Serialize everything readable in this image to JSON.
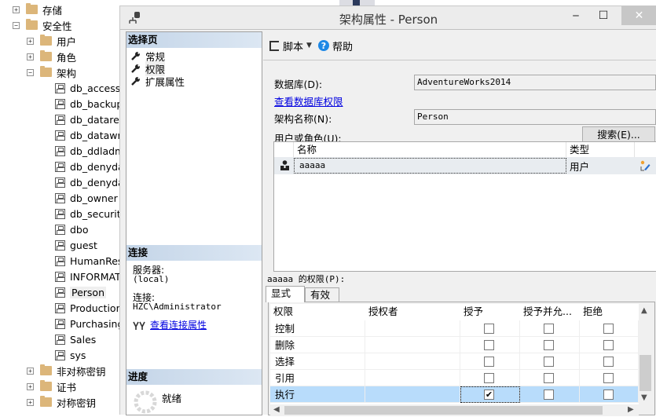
{
  "tree": {
    "nodes": [
      {
        "label": "存储",
        "type": "folder",
        "expander": "+",
        "level": 0
      },
      {
        "label": "安全性",
        "type": "folder",
        "expander": "-",
        "level": 0
      },
      {
        "label": "用户",
        "type": "folder",
        "expander": "+",
        "level": 1
      },
      {
        "label": "角色",
        "type": "folder",
        "expander": "+",
        "level": 1
      },
      {
        "label": "架构",
        "type": "folder",
        "expander": "-",
        "level": 1
      },
      {
        "label": "db_accessadmin",
        "type": "schema",
        "level": 2
      },
      {
        "label": "db_backupoperator",
        "type": "schema",
        "level": 2
      },
      {
        "label": "db_datareader",
        "type": "schema",
        "level": 2
      },
      {
        "label": "db_datawriter",
        "type": "schema",
        "level": 2
      },
      {
        "label": "db_ddladmin",
        "type": "schema",
        "level": 2
      },
      {
        "label": "db_denydatareader",
        "type": "schema",
        "level": 2
      },
      {
        "label": "db_denydatawriter",
        "type": "schema",
        "level": 2
      },
      {
        "label": "db_owner",
        "type": "schema",
        "level": 2
      },
      {
        "label": "db_securityadmin",
        "type": "schema",
        "level": 2
      },
      {
        "label": "dbo",
        "type": "schema",
        "level": 2
      },
      {
        "label": "guest",
        "type": "schema",
        "level": 2
      },
      {
        "label": "HumanResources",
        "type": "schema",
        "level": 2
      },
      {
        "label": "INFORMATION_SCHEMA",
        "type": "schema",
        "level": 2
      },
      {
        "label": "Person",
        "type": "schema",
        "level": 2,
        "selected": true
      },
      {
        "label": "Production",
        "type": "schema",
        "level": 2
      },
      {
        "label": "Purchasing",
        "type": "schema",
        "level": 2
      },
      {
        "label": "Sales",
        "type": "schema",
        "level": 2
      },
      {
        "label": "sys",
        "type": "schema",
        "level": 2
      },
      {
        "label": "非对称密钥",
        "type": "folder",
        "expander": "+",
        "level": 1
      },
      {
        "label": "证书",
        "type": "folder",
        "expander": "+",
        "level": 1
      },
      {
        "label": "对称密钥",
        "type": "folder",
        "expander": "+",
        "level": 1
      }
    ]
  },
  "dialog": {
    "title": "架构属性 - Person",
    "window_buttons": {
      "minimize": "‒",
      "maximize": "☐",
      "close": "✕"
    },
    "select_page": {
      "header": "选择页",
      "items": [
        {
          "label": "常规",
          "icon": "wrench-icon"
        },
        {
          "label": "权限",
          "icon": "wrench-icon",
          "selected": true
        },
        {
          "label": "扩展属性",
          "icon": "wrench-icon"
        }
      ]
    },
    "connection": {
      "header": "连接",
      "server_label": "服务器:",
      "server_value": "(local)",
      "connection_label": "连接:",
      "connection_value": "HZC\\Administrator",
      "view_props_link": "查看连接属性"
    },
    "progress": {
      "header": "进度",
      "status": "就绪"
    },
    "toolbar": {
      "script_label": "脚本",
      "help_label": "帮助"
    },
    "form": {
      "database_label": "数据库(D):",
      "database_value": "AdventureWorks2014",
      "view_db_perms_link": "查看数据库权限",
      "schema_name_label": "架构名称(N):",
      "schema_name_value": "Person",
      "users_roles_label": "用户或角色(U):",
      "search_button": "搜索(E)..."
    },
    "users_grid": {
      "columns": [
        "名称",
        "类型"
      ],
      "rows": [
        {
          "name": "aaaaa",
          "type": "用户"
        }
      ]
    },
    "permissions": {
      "label": "aaaaa 的权限(P):",
      "tabs": [
        "显式",
        "有效"
      ],
      "active_tab": "显式",
      "columns": [
        "权限",
        "授权者",
        "授予",
        "授予并允...",
        "拒绝"
      ],
      "rows": [
        {
          "permission": "控制",
          "grantor": "",
          "grant": false,
          "with_grant": false,
          "deny": false
        },
        {
          "permission": "删除",
          "grantor": "",
          "grant": false,
          "with_grant": false,
          "deny": false
        },
        {
          "permission": "选择",
          "grantor": "",
          "grant": false,
          "with_grant": false,
          "deny": false
        },
        {
          "permission": "引用",
          "grantor": "",
          "grant": false,
          "with_grant": false,
          "deny": false
        },
        {
          "permission": "执行",
          "grantor": "",
          "grant": true,
          "with_grant": false,
          "deny": false,
          "selected": true
        }
      ]
    }
  }
}
